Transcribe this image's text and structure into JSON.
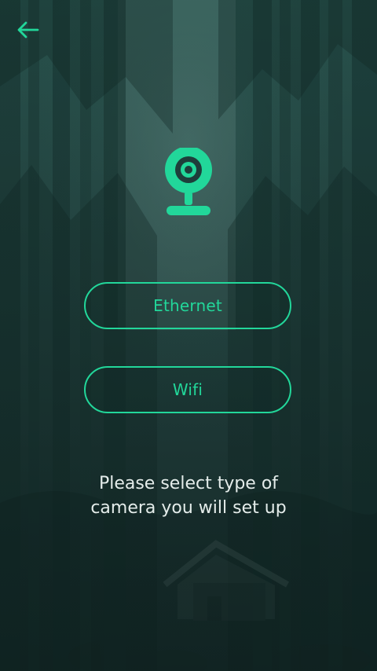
{
  "screen": {
    "back_icon": "arrow-left-icon",
    "camera_icon": "webcam-icon",
    "accent_color": "#22d79a",
    "text_color": "#e4ecea"
  },
  "options": [
    {
      "label": "Ethernet"
    },
    {
      "label": "Wifi"
    }
  ],
  "prompt": {
    "line1": "Please select type of",
    "line2": "camera you will set up"
  }
}
